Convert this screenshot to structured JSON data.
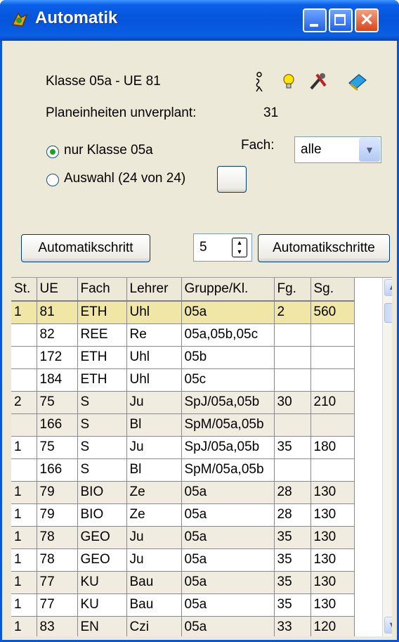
{
  "window": {
    "title": "Automatik",
    "accent": "#0a56d8",
    "panel_bg": "#ece9d8"
  },
  "header": {
    "class_ue": "Klasse 05a - UE 81",
    "unplanned_label": "Planeinheiten unverplant:",
    "unplanned_value": "31",
    "icons": [
      "person-icon",
      "lightbulb-icon",
      "tools-icon",
      "book-icon"
    ]
  },
  "options": {
    "radio_only": "nur Klasse 05a",
    "radio_selection": "Auswahl (24 von 24)",
    "selected": "nur Klasse 05a",
    "fach_label": "Fach:",
    "fach_value": "alle"
  },
  "controls": {
    "step_button": "Automatikschritt",
    "steps_value": "5",
    "steps_button": "Automatikschritte"
  },
  "table": {
    "columns": [
      "St.",
      "UE",
      "Fach",
      "Lehrer",
      "Gruppe/Kl.",
      "Fg.",
      "Sg."
    ],
    "rows": [
      [
        "1",
        "81",
        "ETH",
        "Uhl",
        "05a",
        "2",
        "560"
      ],
      [
        "",
        "82",
        "REE",
        "Re",
        "05a,05b,05c",
        "",
        ""
      ],
      [
        "",
        "172",
        "ETH",
        "Uhl",
        "05b",
        "",
        ""
      ],
      [
        "",
        "184",
        "ETH",
        "Uhl",
        "05c",
        "",
        ""
      ],
      [
        "2",
        "75",
        "S",
        "Ju",
        "SpJ/05a,05b",
        "30",
        "210"
      ],
      [
        "",
        "166",
        "S",
        "Bl",
        "SpM/05a,05b",
        "",
        ""
      ],
      [
        "1",
        "75",
        "S",
        "Ju",
        "SpJ/05a,05b",
        "35",
        "180"
      ],
      [
        "",
        "166",
        "S",
        "Bl",
        "SpM/05a,05b",
        "",
        ""
      ],
      [
        "1",
        "79",
        "BIO",
        "Ze",
        "05a",
        "28",
        "130"
      ],
      [
        "1",
        "79",
        "BIO",
        "Ze",
        "05a",
        "28",
        "130"
      ],
      [
        "1",
        "78",
        "GEO",
        "Ju",
        "05a",
        "35",
        "130"
      ],
      [
        "1",
        "78",
        "GEO",
        "Ju",
        "05a",
        "35",
        "130"
      ],
      [
        "1",
        "77",
        "KU",
        "Bau",
        "05a",
        "35",
        "130"
      ],
      [
        "1",
        "77",
        "KU",
        "Bau",
        "05a",
        "35",
        "130"
      ],
      [
        "1",
        "83",
        "EN",
        "Czi",
        "05a",
        "33",
        "120"
      ]
    ]
  }
}
